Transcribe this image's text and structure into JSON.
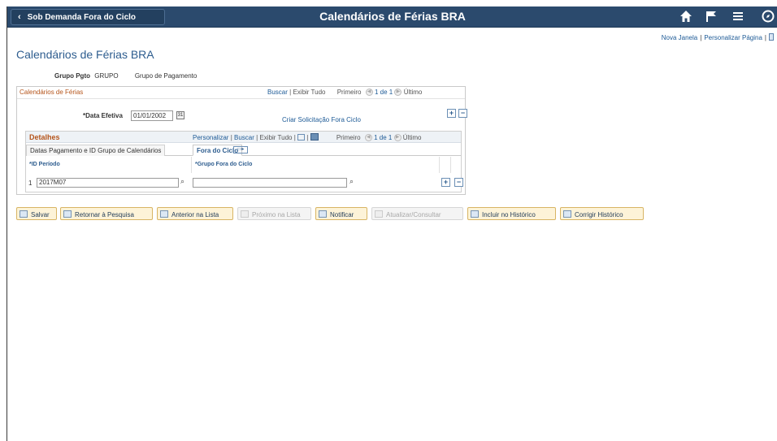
{
  "header": {
    "back_label": "Sob Demanda Fora do Ciclo",
    "back_chevron": "‹",
    "title": "Calendários de Férias BRA",
    "icons": [
      "home-icon",
      "flag-icon",
      "menu-icon",
      "navigator-icon"
    ]
  },
  "top_links": {
    "new_window": "Nova Janela",
    "personalize": "Personalizar Página"
  },
  "page": {
    "title": "Calendários de Férias BRA",
    "group_label": "Grupo Pgto",
    "group_value": "GRUPO",
    "group_desc": "Grupo de Pagamento"
  },
  "calendar_panel": {
    "title": "Calendários de Férias",
    "find": "Buscar",
    "sep": "|",
    "view_all": "Exibir Tudo",
    "first": "Primeiro",
    "page_of": "1 de 1",
    "last": "Último",
    "effective_date_label": "*Data Efetiva",
    "effective_date_value": "01/01/2002",
    "create_request": "Criar Solicitação Fora Ciclo",
    "add": "+",
    "remove": "−"
  },
  "details": {
    "title": "Detalhes",
    "personalize": "Personalizar",
    "find": "Buscar",
    "view_all": "Exibir Tudo",
    "first": "Primeiro",
    "page_of": "1 de 1",
    "last": "Último",
    "tabs": [
      {
        "label": "Datas Pagamento e ID Grupo de Calendários",
        "active": false
      },
      {
        "label": "Fora do Ciclo",
        "active": true
      }
    ],
    "columns": [
      "*ID Período",
      "*Grupo Fora do Ciclo"
    ],
    "rows": [
      {
        "num": "1",
        "period_id": "2017M07",
        "group": ""
      }
    ]
  },
  "toolbar": {
    "buttons": [
      {
        "label": "Salvar",
        "enabled": true
      },
      {
        "label": "Retornar à Pesquisa",
        "enabled": true
      },
      {
        "label": "Anterior na Lista",
        "enabled": true
      },
      {
        "label": "Próximo na Lista",
        "enabled": false
      },
      {
        "label": "Notificar",
        "enabled": true
      },
      {
        "label": "Atualizar/Consultar",
        "enabled": false
      },
      {
        "label": "Incluir no Histórico",
        "enabled": true
      },
      {
        "label": "Corrigir Histórico",
        "enabled": true
      }
    ]
  },
  "colors": {
    "banner": "#2b4a6d",
    "link": "#1d5a96",
    "section_title": "#b5541a",
    "button_bg": "#fdf3d8"
  }
}
